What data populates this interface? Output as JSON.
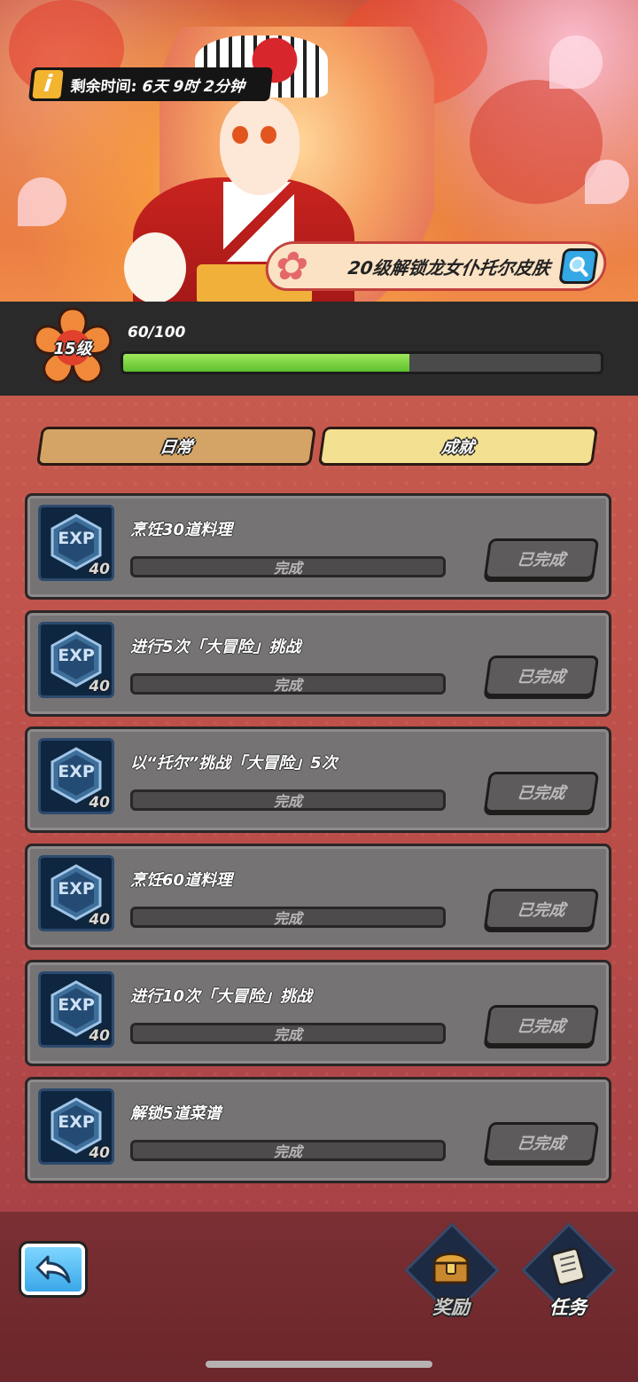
{
  "timer": {
    "label": "剩余时间:",
    "value": "6天 9时 2分钟"
  },
  "unlock": {
    "text": "20级解锁龙女仆托尔皮肤"
  },
  "level": {
    "label": "15级",
    "xp_text": "60/100",
    "xp_fraction": 0.6
  },
  "tabs": [
    {
      "label": "日常",
      "active": false
    },
    {
      "label": "成就",
      "active": true
    }
  ],
  "tasks": [
    {
      "title": "烹饪30道料理",
      "exp_label": "EXP",
      "exp_amount": "40",
      "progress_text": "完成",
      "button": "已完成"
    },
    {
      "title": "进行5次「大冒险」挑战",
      "exp_label": "EXP",
      "exp_amount": "40",
      "progress_text": "完成",
      "button": "已完成"
    },
    {
      "title": "以“托尔”挑战「大冒险」5次",
      "exp_label": "EXP",
      "exp_amount": "40",
      "progress_text": "完成",
      "button": "已完成"
    },
    {
      "title": "烹饪60道料理",
      "exp_label": "EXP",
      "exp_amount": "40",
      "progress_text": "完成",
      "button": "已完成"
    },
    {
      "title": "进行10次「大冒险」挑战",
      "exp_label": "EXP",
      "exp_amount": "40",
      "progress_text": "完成",
      "button": "已完成"
    },
    {
      "title": "解锁5道菜谱",
      "exp_label": "EXP",
      "exp_amount": "40",
      "progress_text": "完成",
      "button": "已完成"
    }
  ],
  "nav": {
    "reward_label": "奖励",
    "tasks_label": "任务",
    "back_icon": "back-arrow-icon"
  },
  "colors": {
    "accent_green": "#5dc02e",
    "tab_active": "#f3e091",
    "tab_inactive": "#d3a465",
    "button_blue": "#34a7e5"
  }
}
